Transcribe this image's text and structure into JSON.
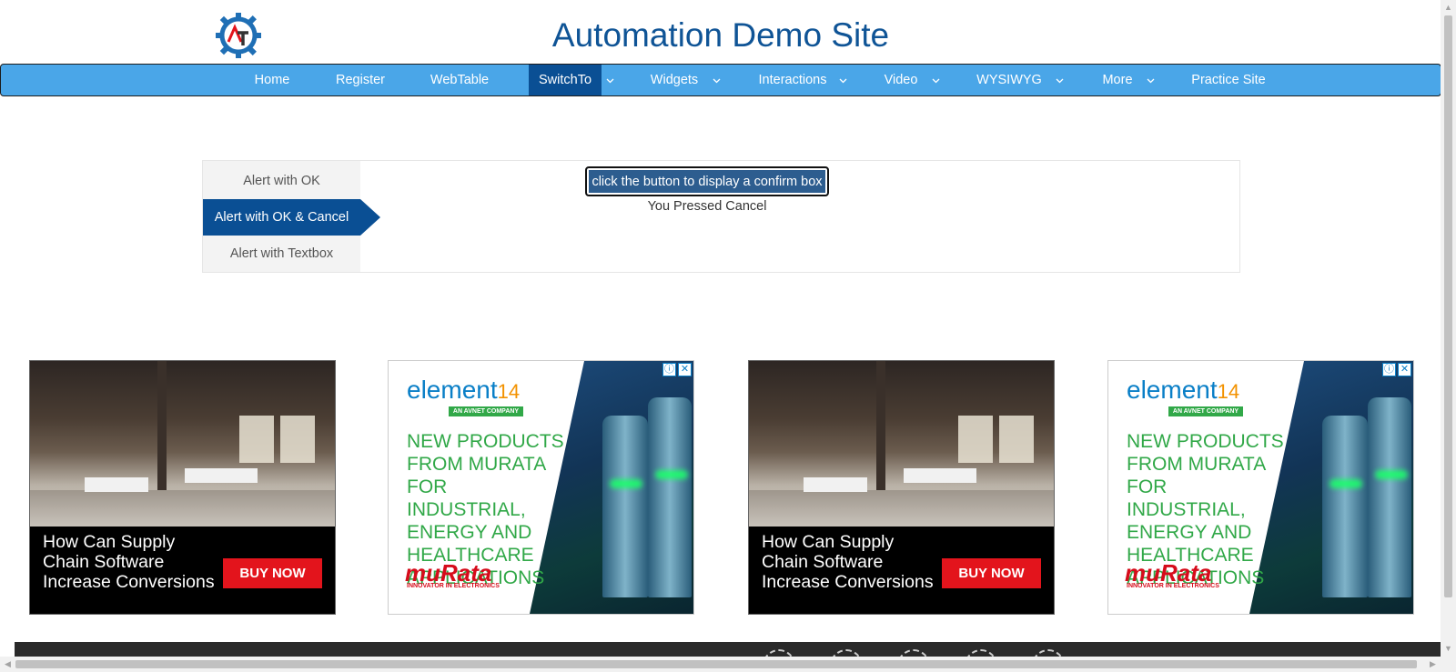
{
  "header": {
    "title": "Automation Demo Site"
  },
  "nav": {
    "items": [
      {
        "label": "Home"
      },
      {
        "label": "Register"
      },
      {
        "label": "WebTable"
      },
      {
        "label": "SwitchTo"
      },
      {
        "label": "Widgets"
      },
      {
        "label": "Interactions"
      },
      {
        "label": "Video"
      },
      {
        "label": "WYSIWYG"
      },
      {
        "label": "More"
      },
      {
        "label": "Practice Site"
      }
    ],
    "active": "SwitchTo"
  },
  "tabs": {
    "items": [
      {
        "label": "Alert with OK"
      },
      {
        "label": "Alert with OK & Cancel"
      },
      {
        "label": "Alert with Textbox"
      }
    ],
    "active": "Alert with OK & Cancel"
  },
  "main": {
    "confirm_button": "click the button to display a confirm box",
    "result": "You Pressed Cancel"
  },
  "ads": {
    "office": {
      "headline": "How Can Supply Chain Software Increase Conversions",
      "cta": "BUY NOW"
    },
    "element14": {
      "brand": "element",
      "brand_num": "14",
      "tagline": "AN AVNET COMPANY",
      "headline": "NEW PRODUCTS FROM MURATA FOR INDUSTRIAL, ENERGY AND HEALTHCARE APPLICATIONS",
      "murata": "muRata",
      "murata_sub": "INNOVATOR IN ELECTRONICS",
      "info_icon": "ⓘ",
      "close_icon": "✕"
    }
  },
  "colors": {
    "brand_blue": "#0f5496",
    "nav_bg": "#4aa6e8",
    "active_bg": "#0a4f94",
    "buy_red": "#e3141c",
    "element_green": "#31a848"
  }
}
